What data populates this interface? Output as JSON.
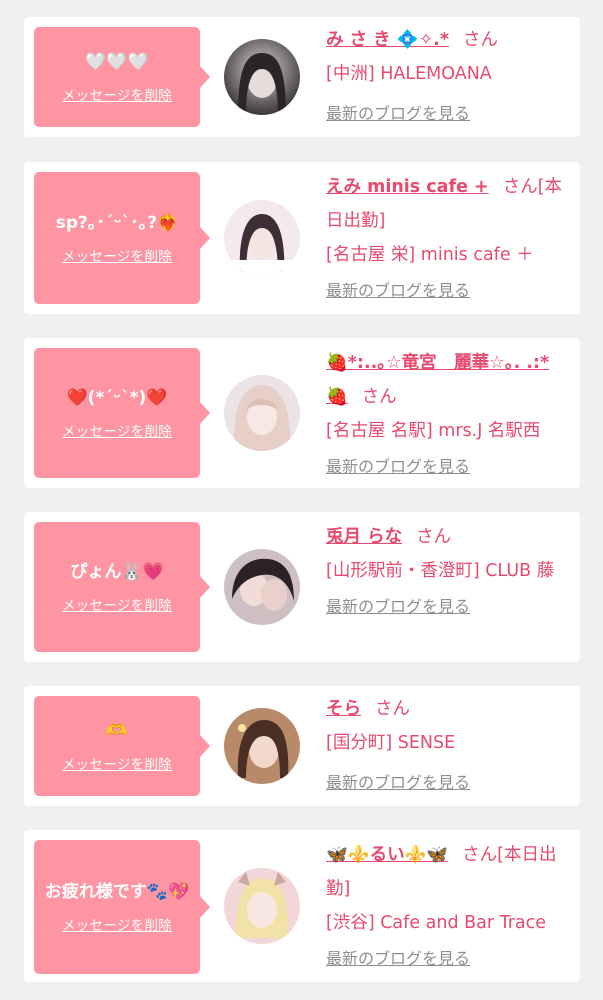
{
  "colors": {
    "accent": "#e74a6e",
    "bubble": "#ff94a3",
    "muted": "#8f8f8f"
  },
  "cards": [
    {
      "message": "🤍🤍🤍",
      "delete_label": "メッセージを削除",
      "name": "み さ き 💠✧.*",
      "honorific": "さん",
      "shop": "[中洲] HALEMOANA",
      "blog_label": "最新のブログを見る"
    },
    {
      "message": "sp?｡･´ᵕ`･｡?❤️‍🔥",
      "delete_label": "メッセージを削除",
      "name": "えみ minis cafe +",
      "honorific": "さん[本日出勤]",
      "shop": "[名古屋 栄] minis cafe ＋",
      "blog_label": "最新のブログを見る"
    },
    {
      "message": "❤️(*´ᵕ`*)❤️",
      "delete_label": "メッセージを削除",
      "name": "🍓*:..｡☆竜宮　麗華☆｡. .:*🍓",
      "honorific": "さん",
      "shop": "[名古屋 名駅] mrs.J 名駅西",
      "blog_label": "最新のブログを見る"
    },
    {
      "message": "ぴょん🐰💗",
      "delete_label": "メッセージを削除",
      "name": "兎月 らな",
      "honorific": "さん",
      "shop": "[山形駅前・香澄町] CLUB 藤",
      "blog_label": "最新のブログを見る"
    },
    {
      "message": "🫶",
      "delete_label": "メッセージを削除",
      "name": "そら",
      "honorific": "さん",
      "shop": "[国分町] SENSE",
      "blog_label": "最新のブログを見る"
    },
    {
      "message": "お疲れ様です🐾💖",
      "delete_label": "メッセージを削除",
      "name": "🦋⚜️るい⚜️🦋",
      "honorific": "さん[本日出勤]",
      "shop": "[渋谷] Cafe and Bar Trace",
      "blog_label": "最新のブログを見る"
    }
  ]
}
